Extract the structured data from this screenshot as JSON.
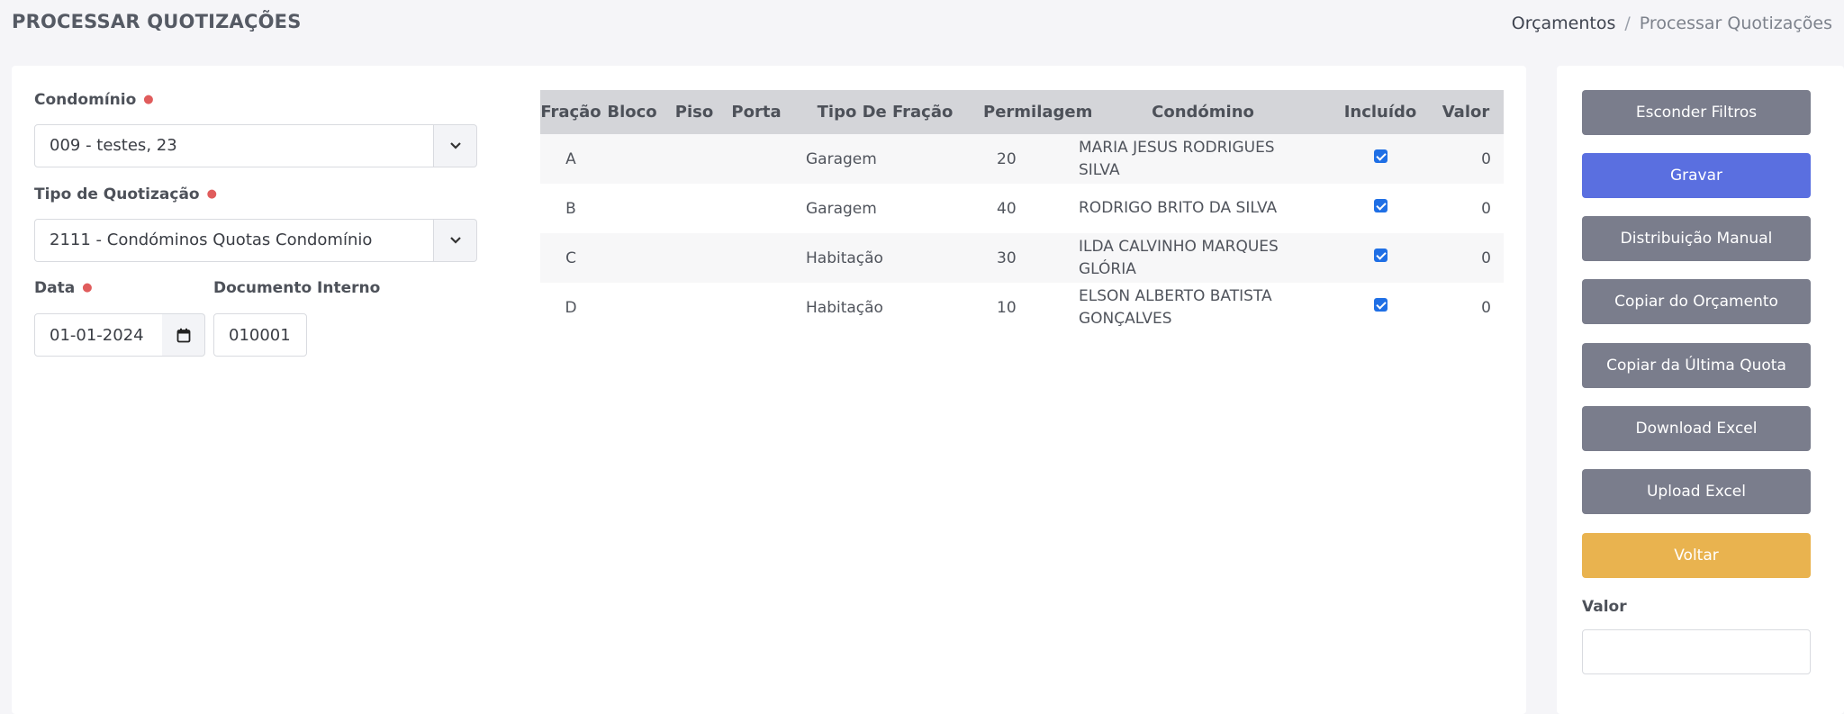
{
  "header": {
    "title": "PROCESSAR QUOTIZAÇÕES",
    "breadcrumb": {
      "parent": "Orçamentos",
      "separator": "/",
      "current": "Processar Quotizações"
    }
  },
  "form": {
    "condominio": {
      "label": "Condomínio",
      "value": "009 - testes, 23"
    },
    "tipo_quotizacao": {
      "label": "Tipo de Quotização",
      "value": "2111 - Condóminos Quotas Condomínio"
    },
    "data": {
      "label": "Data",
      "value": "01-01-2024"
    },
    "documento_interno": {
      "label": "Documento Interno",
      "value": "010001"
    }
  },
  "table": {
    "columns": [
      "Fração",
      "Bloco",
      "Piso",
      "Porta",
      "Tipo De Fração",
      "Permilagem",
      "Condómino",
      "Incluído",
      "Valor"
    ],
    "rows": [
      {
        "fracao": "A",
        "bloco": "",
        "piso": "",
        "porta": "",
        "tipo": "Garagem",
        "permilagem": "20",
        "condomino": "MARIA JESUS RODRIGUES SILVA",
        "incluido": true,
        "valor": "0"
      },
      {
        "fracao": "B",
        "bloco": "",
        "piso": "",
        "porta": "",
        "tipo": "Garagem",
        "permilagem": "40",
        "condomino": "RODRIGO BRITO DA SILVA",
        "incluido": true,
        "valor": "0"
      },
      {
        "fracao": "C",
        "bloco": "",
        "piso": "",
        "porta": "",
        "tipo": "Habitação",
        "permilagem": "30",
        "condomino": "ILDA CALVINHO MARQUES GLÓRIA",
        "incluido": true,
        "valor": "0"
      },
      {
        "fracao": "D",
        "bloco": "",
        "piso": "",
        "porta": "",
        "tipo": "Habitação",
        "permilagem": "10",
        "condomino": "ELSON ALBERTO BATISTA GONÇALVES",
        "incluido": true,
        "valor": "0"
      }
    ]
  },
  "sidebar": {
    "buttons": {
      "esconder_filtros": "Esconder Filtros",
      "gravar": "Gravar",
      "distribuicao_manual": "Distribuição Manual",
      "copiar_orcamento": "Copiar do Orçamento",
      "copiar_ultima_quota": "Copiar da Última Quota",
      "download_excel": "Download Excel",
      "upload_excel": "Upload Excel",
      "voltar": "Voltar"
    },
    "valor": {
      "label": "Valor",
      "value": ""
    }
  },
  "icons": {
    "select_chevron": "chevron-down-icon",
    "date_picker": "calendar-icon"
  },
  "colors": {
    "primary": "#5a6fe0",
    "secondary": "#7a7d8c",
    "warning": "#e9b34f",
    "required": "#e05c5c",
    "checkbox": "#1f6fe5"
  }
}
